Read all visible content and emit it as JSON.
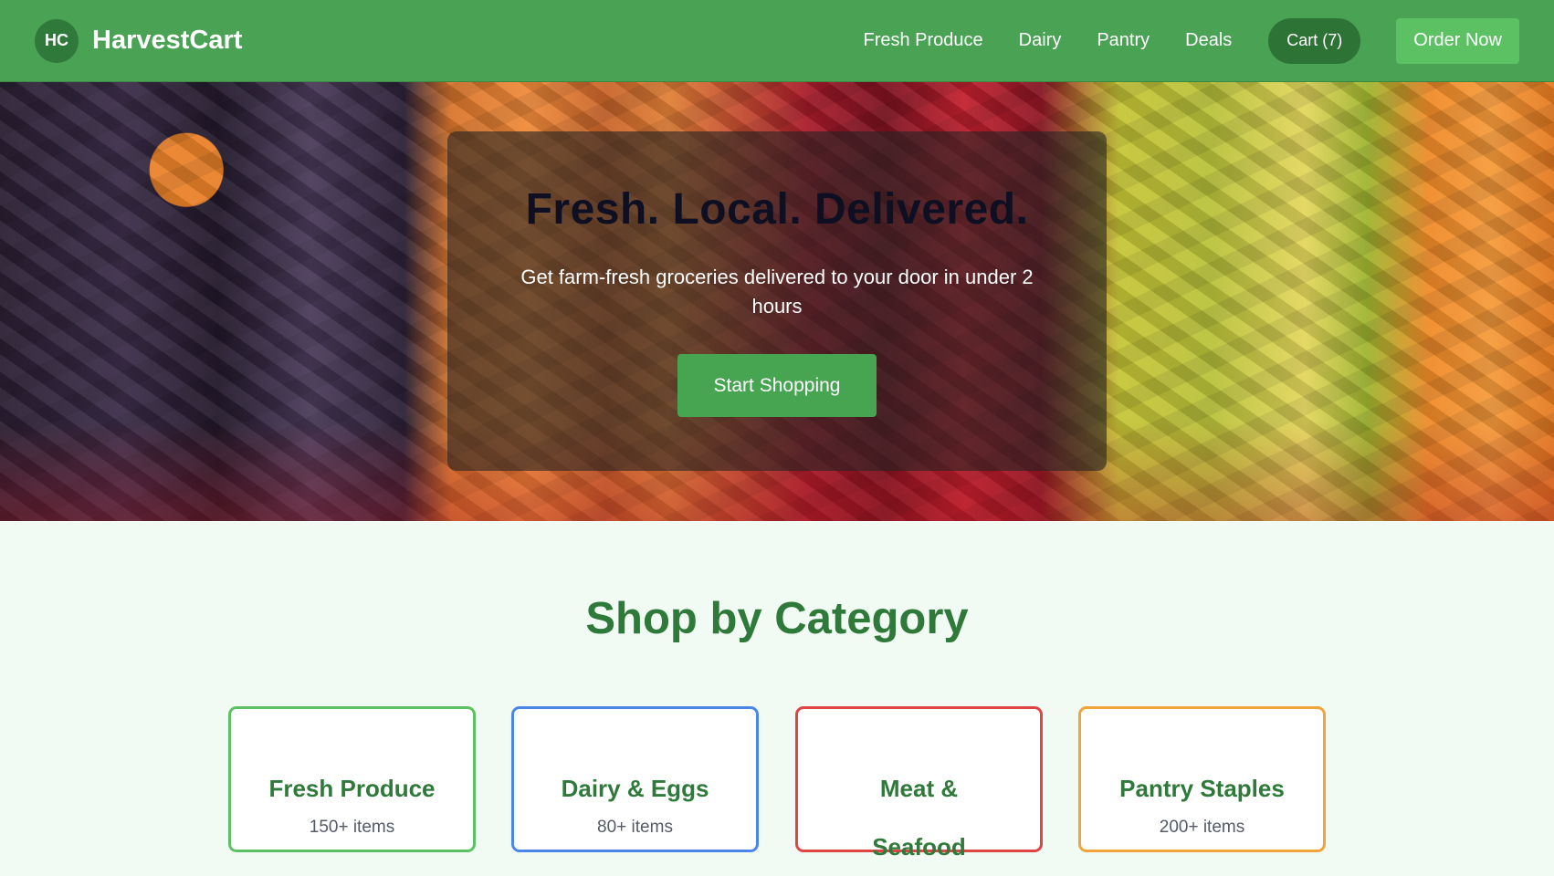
{
  "nav": {
    "logo_initials": "HC",
    "brand": "HarvestCart",
    "links": [
      "Fresh Produce",
      "Dairy",
      "Pantry",
      "Deals"
    ],
    "cart_label": "Cart (7)",
    "order_label": "Order Now"
  },
  "hero": {
    "title": "Fresh. Local. Delivered.",
    "subtitle": "Get farm-fresh groceries delivered to your door in under 2 hours",
    "cta": "Start Shopping"
  },
  "categories": {
    "heading": "Shop by Category",
    "items": [
      {
        "name": "Fresh Produce",
        "count": "150+ items",
        "border": "#5cc163"
      },
      {
        "name": "Dairy & Eggs",
        "count": "80+ items",
        "border": "#4a86e8"
      },
      {
        "name": "Meat & Seafood",
        "count": "",
        "border": "#e04545"
      },
      {
        "name": "Pantry Staples",
        "count": "200+ items",
        "border": "#f0a43a"
      }
    ]
  },
  "colors": {
    "nav_bg": "#4aa354",
    "accent_dark": "#2f7a3a",
    "cta_green": "#47a552"
  }
}
